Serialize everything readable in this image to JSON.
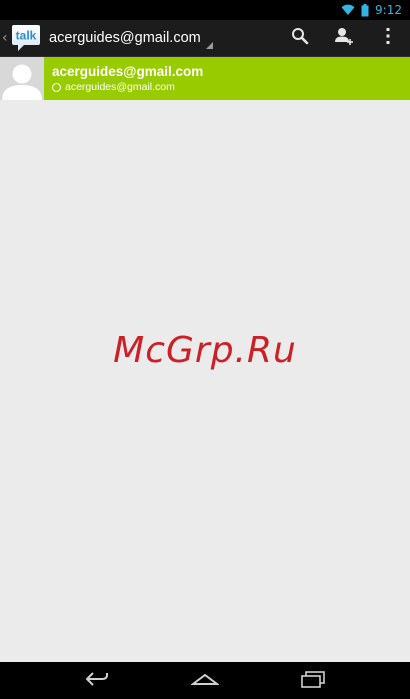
{
  "status_bar": {
    "time": "9:12",
    "icons": [
      "wifi-icon",
      "battery-icon"
    ],
    "accent_color": "#33b5e5"
  },
  "action_bar": {
    "app_logo_text": "talk",
    "account": "acerguides@gmail.com",
    "actions": [
      "search-icon",
      "add-friend-icon",
      "overflow-menu-icon"
    ]
  },
  "contacts": [
    {
      "name": "acerguides@gmail.com",
      "status": "acerguides@gmail.com",
      "selected_color": "#99cc00"
    }
  ],
  "watermark": "McGrp.Ru",
  "nav_bar": {
    "buttons": [
      "back-icon",
      "home-icon",
      "recent-apps-icon"
    ]
  }
}
